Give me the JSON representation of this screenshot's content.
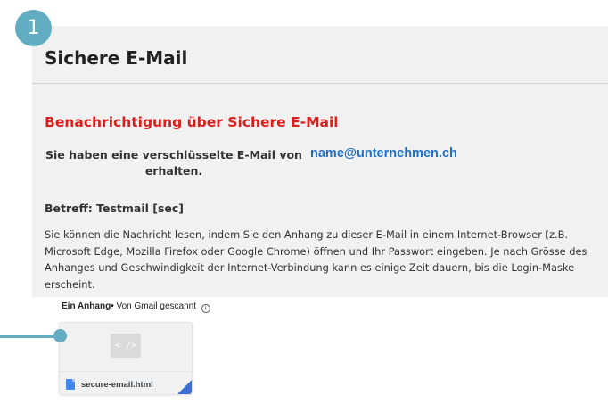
{
  "step": {
    "number": "1",
    "color": "#62adc1"
  },
  "email": {
    "title": "Sichere E-Mail",
    "notice_heading": "Benachrichtigung über Sichere E-Mail",
    "sender_label": "Sie haben eine verschlüsselte E-Mail von erhalten.",
    "sender_address": "name@unternehmen.ch",
    "subject": "Betreff: Testmail [sec]",
    "body": "Sie können die Nachricht lesen, indem Sie den Anhang zu dieser E-Mail in einem Internet-Browser (z.B. Microsoft Edge, Mozilla Firefox oder Google Chrome) öffnen und Ihr Passwort eingeben. Je nach Grösse des Anhanges und Geschwindigkeit der Internet-Verbindung kann es einige Zeit dauern, bis die Login-Maske erscheint."
  },
  "attachments": {
    "count_label": "Ein Anhang",
    "separator": "•",
    "scan_label": "Von Gmail gescannt",
    "info_icon": "ⓘ",
    "files": [
      {
        "name": "secure-email.html",
        "icon": "file-icon",
        "preview_glyph": "< />"
      }
    ]
  },
  "colors": {
    "accent": "#62adc1",
    "heading_red": "#d9201f",
    "link_blue": "#1f6fcb",
    "panel_bg": "#f1f1f1"
  }
}
